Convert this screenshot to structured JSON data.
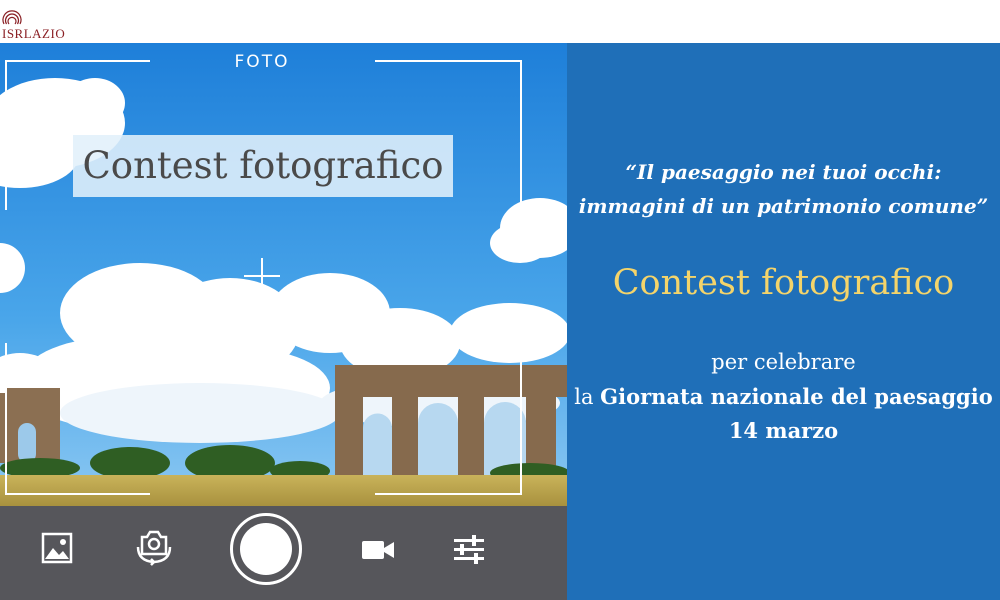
{
  "logo": {
    "text": "ISRLAZIO"
  },
  "viewfinder": {
    "mode_label": "FOTO",
    "overlay_title": "Contest fotografico"
  },
  "controls": {
    "gallery_icon": "image-icon",
    "flip_icon": "camera-switch-icon",
    "shutter_icon": "shutter-button",
    "video_icon": "video-camera-icon",
    "settings_icon": "sliders-icon"
  },
  "panel": {
    "quote_line1": "“Il paesaggio nei tuoi occhi:",
    "quote_line2": "immagini di un patrimonio comune”",
    "title": "Contest fotografico",
    "line1": "per celebrare",
    "line2_prefix": "la ",
    "line2_bold": "Giornata nazionale del paesaggio",
    "line3": "14 marzo"
  },
  "colors": {
    "panel_bg": "#1f6fb8",
    "title_gold": "#f4d46a",
    "controls_bg": "#56565b",
    "sky": "#2f8fe0"
  }
}
